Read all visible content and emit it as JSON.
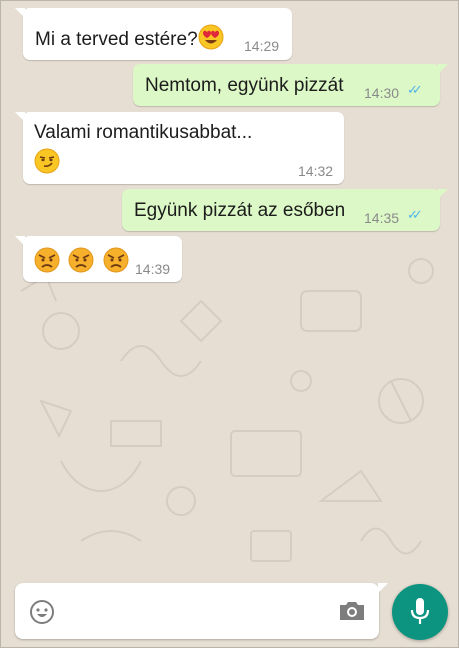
{
  "chat": {
    "messages": [
      {
        "direction": "incoming",
        "text": "Mi a terved estére?",
        "emojis": [
          "smiling-face-with-heart-eyes"
        ],
        "time": "14:29"
      },
      {
        "direction": "outgoing",
        "text": "Nemtom, együnk pizzát",
        "time": "14:30",
        "status": "read"
      },
      {
        "direction": "incoming",
        "text": "Valami romantikusabbat...",
        "emojis": [
          "smirking-face"
        ],
        "time": "14:32"
      },
      {
        "direction": "outgoing",
        "text": "Együnk pizzát az esőben",
        "time": "14:35",
        "status": "read"
      },
      {
        "direction": "incoming",
        "text": "",
        "emojis": [
          "angry-face",
          "angry-face",
          "angry-face"
        ],
        "time": "14:39"
      }
    ]
  },
  "composer": {
    "placeholder": "",
    "value": "",
    "icons": {
      "emoji": "emoji-icon",
      "camera": "camera-icon",
      "mic": "microphone-icon"
    }
  },
  "colors": {
    "background": "#e6ded3",
    "incoming_bubble": "#ffffff",
    "outgoing_bubble": "#dcf8c6",
    "read_ticks": "#4fb6ec",
    "mic_button": "#0d9480"
  }
}
